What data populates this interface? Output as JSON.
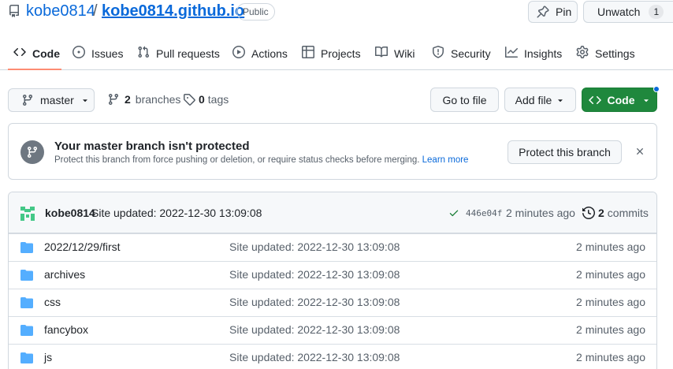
{
  "repo": {
    "owner": "kobe0814",
    "separator": "/",
    "name": "kobe0814.github.io",
    "visibility": "Public"
  },
  "actions": {
    "pin_label": "Pin",
    "watch_label": "Unwatch",
    "watch_count": "1"
  },
  "tabs": [
    {
      "label": "Code",
      "icon": "code-icon"
    },
    {
      "label": "Issues",
      "icon": "issue-icon"
    },
    {
      "label": "Pull requests",
      "icon": "pull-request-icon"
    },
    {
      "label": "Actions",
      "icon": "play-icon"
    },
    {
      "label": "Projects",
      "icon": "table-icon"
    },
    {
      "label": "Wiki",
      "icon": "book-icon"
    },
    {
      "label": "Security",
      "icon": "shield-icon"
    },
    {
      "label": "Insights",
      "icon": "graph-icon"
    },
    {
      "label": "Settings",
      "icon": "gear-icon"
    }
  ],
  "branch_bar": {
    "branch": "master",
    "branch_count": "2",
    "branches_label": "branches",
    "tag_count": "0",
    "tags_label": "tags",
    "goto_label": "Go to file",
    "addfile_label": "Add file",
    "code_label": "Code"
  },
  "protection": {
    "title": "Your master branch isn't protected",
    "desc": "Protect this branch from force pushing or deletion, or require status checks before merging.",
    "link": "Learn more",
    "button": "Protect this branch"
  },
  "commit": {
    "author": "kobe0814",
    "message": "Site updated: 2022-12-30 13:09:08",
    "sha": "446e04f",
    "time": "2 minutes ago",
    "commit_count": "2",
    "commits_label": "commits"
  },
  "files": [
    {
      "name": "2022/12/29/first",
      "message": "Site updated: 2022-12-30 13:09:08",
      "time": "2 minutes ago"
    },
    {
      "name": "archives",
      "message": "Site updated: 2022-12-30 13:09:08",
      "time": "2 minutes ago"
    },
    {
      "name": "css",
      "message": "Site updated: 2022-12-30 13:09:08",
      "time": "2 minutes ago"
    },
    {
      "name": "fancybox",
      "message": "Site updated: 2022-12-30 13:09:08",
      "time": "2 minutes ago"
    },
    {
      "name": "js",
      "message": "Site updated: 2022-12-30 13:09:08",
      "time": "2 minutes ago"
    }
  ],
  "colors": {
    "link": "#0969da",
    "primary_button": "#1f883d",
    "active_tab_underline": "#fd8c73",
    "folder": "#54aeff"
  }
}
